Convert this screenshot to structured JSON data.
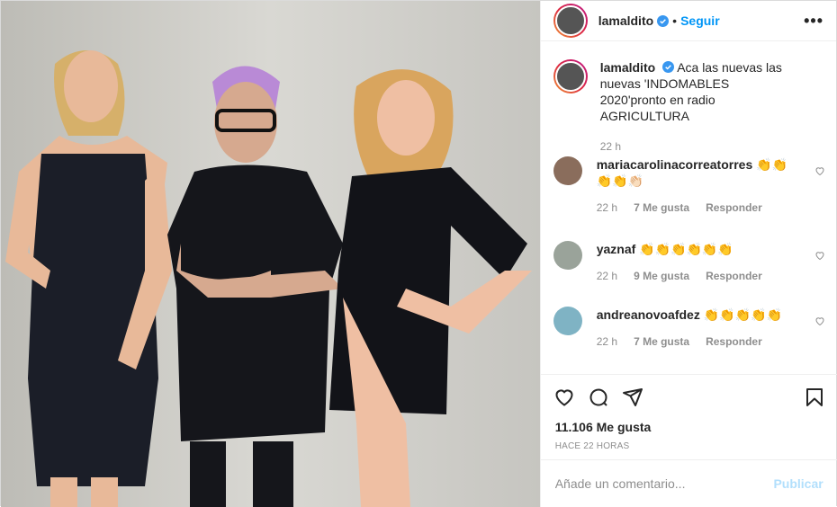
{
  "header": {
    "username": "lamaldito",
    "separator": "•",
    "follow_label": "Seguir",
    "more_label": "•••"
  },
  "caption": {
    "username": "lamaldito",
    "text": "Aca las nuevas las nuevas 'INDOMABLES 2020'pronto en radio AGRICULTURA",
    "time": "22 h"
  },
  "comments": [
    {
      "username": "mariacarolinacorreatorres",
      "text": "👏👏👏👏👏🏻",
      "time": "22 h",
      "likes": "7 Me gusta",
      "reply": "Responder"
    },
    {
      "username": "yaznaf",
      "text": "👏👏👏👏👏👏",
      "time": "22 h",
      "likes": "9 Me gusta",
      "reply": "Responder"
    },
    {
      "username": "andreanovoafdez",
      "text": "👏👏👏👏👏",
      "time": "22 h",
      "likes": "7 Me gusta",
      "reply": "Responder"
    }
  ],
  "footer": {
    "likes": "11.106 Me gusta",
    "ago": "HACE 22 HORAS",
    "comment_placeholder": "Añade un comentario...",
    "publish_label": "Publicar"
  },
  "icons": {
    "like": "heart-icon",
    "comment": "comment-icon",
    "share": "paper-plane-icon",
    "save": "bookmark-icon",
    "verified": "verified-badge-icon",
    "more": "more-options-icon"
  },
  "colors": {
    "accent": "#0095f6",
    "publish_disabled": "#b2dffc",
    "muted": "#8e8e8e"
  }
}
